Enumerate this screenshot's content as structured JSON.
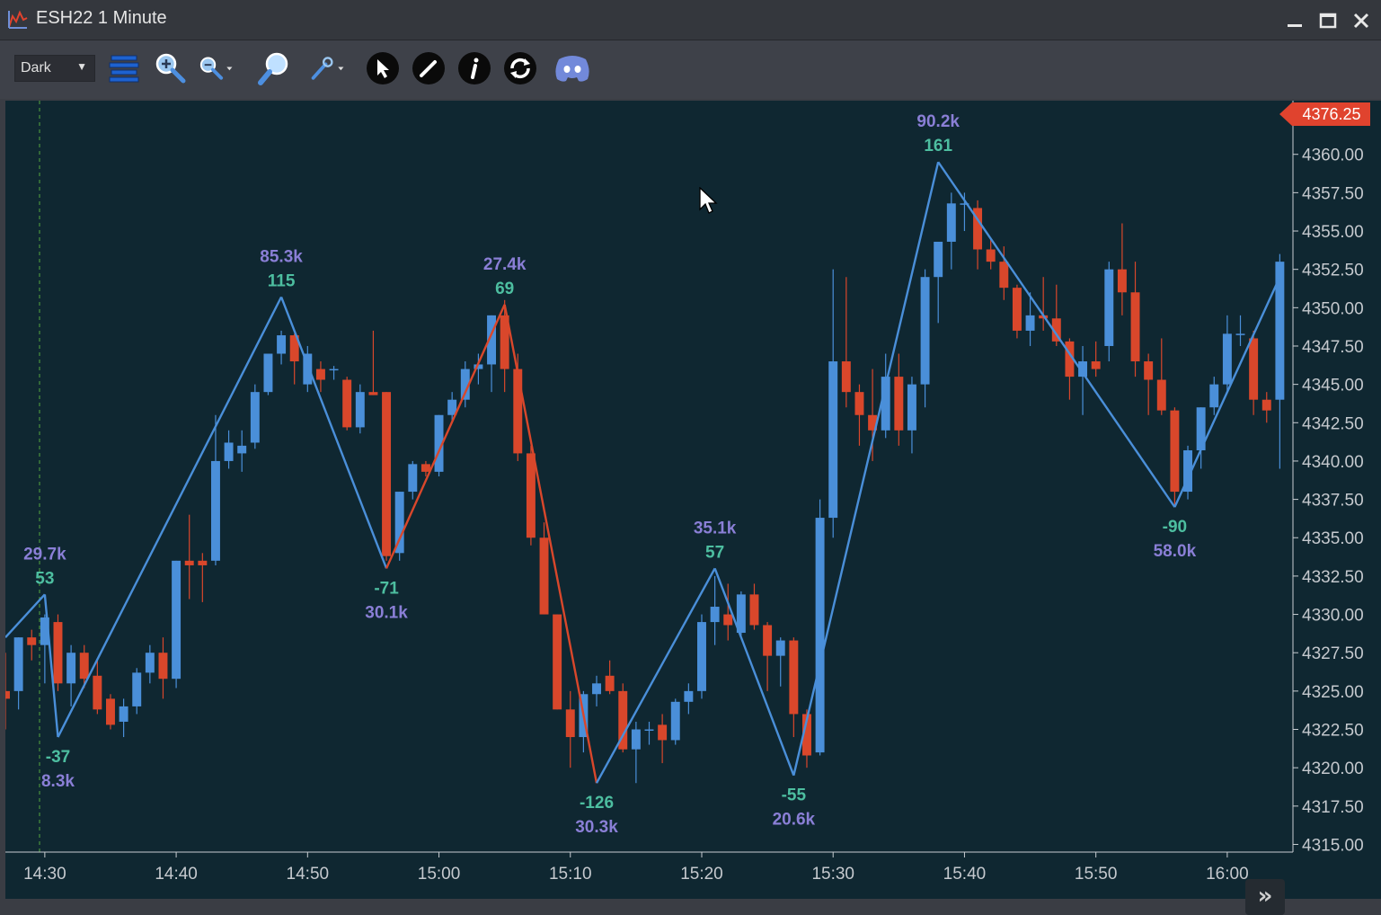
{
  "window": {
    "title": "ESH22 1 Minute"
  },
  "toolbar": {
    "theme_value": "Dark",
    "buttons": [
      {
        "icon": "strip-bars-icon"
      },
      {
        "icon": "zoom-in-icon"
      },
      {
        "icon": "zoom-out-icon"
      },
      {
        "icon": "magnifier-icon"
      },
      {
        "icon": "tools-icon"
      },
      {
        "icon": "pointer-icon"
      },
      {
        "icon": "pencil-icon"
      },
      {
        "icon": "info-icon"
      },
      {
        "icon": "refresh-icon"
      },
      {
        "icon": "discord-icon"
      }
    ]
  },
  "colors": {
    "up": "#4a8fd9",
    "down": "#d9472b",
    "zigzag": "#4a8fd9",
    "label_price": "#4dbea0",
    "label_vol": "#8a7fd6",
    "last_price_bg": "#e0432e"
  },
  "chart_data": {
    "type": "candlestick",
    "symbol": "ESH22",
    "interval": "1 Minute",
    "last_price": "4376.25",
    "x_ticks": [
      "14:30",
      "14:40",
      "14:50",
      "15:00",
      "15:10",
      "15:20",
      "15:30",
      "15:40",
      "15:50",
      "16:00"
    ],
    "y_ticks": [
      "4360.00",
      "4357.50",
      "4355.00",
      "4352.50",
      "4350.00",
      "4347.50",
      "4345.00",
      "4342.50",
      "4340.00",
      "4337.50",
      "4335.00",
      "4332.50",
      "4330.00",
      "4327.50",
      "4325.00",
      "4322.50",
      "4320.00",
      "4317.50",
      "4315.00"
    ],
    "ylim": [
      4314.5,
      4363.5
    ],
    "time_range_minutes": [
      -3,
      95
    ],
    "candles": [
      [
        -3,
        4325.0,
        4327.5,
        4322.5,
        4324.5
      ],
      [
        -2,
        4325.0,
        4328.5,
        4323.8,
        4328.5
      ],
      [
        -1,
        4328.5,
        4329.0,
        4327.0,
        4328.0
      ],
      [
        0,
        4328.0,
        4330.0,
        4325.5,
        4329.8
      ],
      [
        1,
        4329.5,
        4330.0,
        4325.0,
        4325.5
      ],
      [
        2,
        4325.5,
        4328.0,
        4324.0,
        4327.5
      ],
      [
        3,
        4327.5,
        4328.0,
        4325.2,
        4325.8
      ],
      [
        4,
        4326.0,
        4327.0,
        4323.5,
        4323.8
      ],
      [
        5,
        4324.5,
        4324.8,
        4322.5,
        4322.8
      ],
      [
        6,
        4323.0,
        4324.5,
        4322.0,
        4324.0
      ],
      [
        7,
        4324.0,
        4326.5,
        4323.5,
        4326.2
      ],
      [
        8,
        4326.2,
        4328.0,
        4325.5,
        4327.5
      ],
      [
        9,
        4327.5,
        4328.5,
        4324.5,
        4325.8
      ],
      [
        10,
        4325.8,
        4333.5,
        4325.2,
        4333.5
      ],
      [
        11,
        4333.5,
        4336.5,
        4331.0,
        4333.2
      ],
      [
        12,
        4333.5,
        4334.0,
        4330.8,
        4333.2
      ],
      [
        13,
        4333.5,
        4343.0,
        4333.2,
        4340.0
      ],
      [
        14,
        4340.0,
        4342.0,
        4339.5,
        4341.2
      ],
      [
        15,
        4340.5,
        4342.0,
        4339.3,
        4341.0
      ],
      [
        16,
        4341.2,
        4345.0,
        4340.8,
        4344.5
      ],
      [
        17,
        4344.5,
        4347.0,
        4344.3,
        4347.0
      ],
      [
        18,
        4347.0,
        4348.5,
        4346.3,
        4348.2
      ],
      [
        19,
        4348.2,
        4348.3,
        4345.0,
        4346.5
      ],
      [
        20,
        4345.0,
        4347.5,
        4344.5,
        4347.0
      ],
      [
        21,
        4346.0,
        4346.5,
        4344.5,
        4345.3
      ],
      [
        22,
        4346.0,
        4346.2,
        4345.3,
        4346.0
      ],
      [
        23,
        4345.3,
        4345.5,
        4342.0,
        4342.2
      ],
      [
        24,
        4342.2,
        4345.0,
        4341.8,
        4344.5
      ],
      [
        25,
        4344.5,
        4348.5,
        4344.3,
        4344.3
      ],
      [
        26,
        4344.5,
        4344.5,
        4333.5,
        4333.8
      ],
      [
        27,
        4334.0,
        4338.0,
        4333.5,
        4338.0
      ],
      [
        28,
        4338.0,
        4340.0,
        4337.5,
        4339.8
      ],
      [
        29,
        4339.8,
        4340.0,
        4339.0,
        4339.3
      ],
      [
        30,
        4339.3,
        4343.0,
        4339.0,
        4343.0
      ],
      [
        31,
        4343.0,
        4344.5,
        4342.5,
        4344.0
      ],
      [
        32,
        4344.0,
        4346.5,
        4343.5,
        4346.0
      ],
      [
        33,
        4346.0,
        4347.0,
        4345.0,
        4346.3
      ],
      [
        34,
        4346.3,
        4349.5,
        4344.5,
        4349.5
      ],
      [
        35,
        4349.5,
        4350.5,
        4344.5,
        4346.0
      ],
      [
        36,
        4346.0,
        4347.0,
        4340.0,
        4340.5
      ],
      [
        37,
        4340.5,
        4341.0,
        4334.5,
        4335.0
      ],
      [
        38,
        4335.0,
        4336.0,
        4330.0,
        4330.0
      ],
      [
        39,
        4330.0,
        4330.0,
        4323.8,
        4323.8
      ],
      [
        40,
        4323.8,
        4325.0,
        4320.0,
        4322.0
      ],
      [
        41,
        4322.0,
        4325.0,
        4321.0,
        4324.8
      ],
      [
        42,
        4324.8,
        4326.0,
        4324.0,
        4325.5
      ],
      [
        43,
        4326.0,
        4327.0,
        4324.8,
        4325.0
      ],
      [
        44,
        4325.0,
        4325.5,
        4321.0,
        4321.2
      ],
      [
        45,
        4321.2,
        4323.0,
        4319.0,
        4322.5
      ],
      [
        46,
        4322.5,
        4323.0,
        4321.5,
        4322.5
      ],
      [
        47,
        4322.8,
        4323.5,
        4320.3,
        4321.8
      ],
      [
        48,
        4321.8,
        4324.5,
        4321.5,
        4324.3
      ],
      [
        49,
        4324.3,
        4325.5,
        4323.5,
        4325.0
      ],
      [
        50,
        4325.0,
        4330.0,
        4324.5,
        4329.5
      ],
      [
        51,
        4329.5,
        4332.5,
        4328.0,
        4330.5
      ],
      [
        52,
        4330.0,
        4332.0,
        4328.3,
        4329.3
      ],
      [
        53,
        4328.8,
        4331.5,
        4328.5,
        4331.3
      ],
      [
        54,
        4331.3,
        4332.0,
        4329.0,
        4329.3
      ],
      [
        55,
        4329.3,
        4329.5,
        4325.0,
        4327.3
      ],
      [
        56,
        4327.3,
        4328.5,
        4325.3,
        4328.3
      ],
      [
        57,
        4328.3,
        4328.5,
        4322.0,
        4323.5
      ],
      [
        58,
        4323.5,
        4323.8,
        4320.0,
        4320.8
      ],
      [
        59,
        4321.0,
        4337.5,
        4320.8,
        4336.3
      ],
      [
        60,
        4336.3,
        4352.5,
        4335.0,
        4346.5
      ],
      [
        61,
        4346.5,
        4352.0,
        4343.5,
        4344.5
      ],
      [
        62,
        4344.5,
        4345.0,
        4341.0,
        4343.0
      ],
      [
        63,
        4343.0,
        4346.0,
        4340.0,
        4342.0
      ],
      [
        64,
        4342.0,
        4347.0,
        4341.5,
        4345.5
      ],
      [
        65,
        4345.5,
        4347.0,
        4341.0,
        4342.0
      ],
      [
        66,
        4342.0,
        4345.5,
        4340.5,
        4345.0
      ],
      [
        67,
        4345.0,
        4352.5,
        4343.5,
        4352.0
      ],
      [
        68,
        4352.0,
        4354.0,
        4349.0,
        4354.3
      ],
      [
        69,
        4354.3,
        4357.5,
        4352.5,
        4356.8
      ],
      [
        70,
        4356.8,
        4357.5,
        4355.0,
        4356.8
      ],
      [
        71,
        4356.5,
        4357.0,
        4352.5,
        4353.8
      ],
      [
        72,
        4353.8,
        4354.5,
        4352.5,
        4353.0
      ],
      [
        73,
        4353.0,
        4354.0,
        4350.5,
        4351.3
      ],
      [
        74,
        4351.3,
        4351.5,
        4348.0,
        4348.5
      ],
      [
        75,
        4348.5,
        4351.0,
        4347.5,
        4349.5
      ],
      [
        76,
        4349.5,
        4352.0,
        4348.5,
        4349.3
      ],
      [
        77,
        4349.3,
        4351.5,
        4347.5,
        4347.8
      ],
      [
        78,
        4347.8,
        4348.0,
        4344.0,
        4345.5
      ],
      [
        79,
        4345.5,
        4347.5,
        4343.0,
        4346.5
      ],
      [
        80,
        4346.5,
        4347.8,
        4345.5,
        4346.0
      ],
      [
        81,
        4347.5,
        4353.0,
        4346.5,
        4352.5
      ],
      [
        82,
        4352.5,
        4355.5,
        4349.5,
        4351.0
      ],
      [
        83,
        4351.0,
        4353.0,
        4345.5,
        4346.5
      ],
      [
        84,
        4346.5,
        4347.0,
        4343.0,
        4345.3
      ],
      [
        85,
        4345.3,
        4348.0,
        4343.0,
        4343.3
      ],
      [
        86,
        4343.3,
        4343.5,
        4337.0,
        4338.0
      ],
      [
        87,
        4338.0,
        4341.0,
        4337.5,
        4340.7
      ],
      [
        88,
        4340.7,
        4343.5,
        4339.5,
        4343.5
      ],
      [
        89,
        4343.5,
        4345.5,
        4343.0,
        4345.0
      ],
      [
        90,
        4345.0,
        4349.5,
        4344.5,
        4348.3
      ],
      [
        91,
        4348.3,
        4349.5,
        4347.5,
        4348.3
      ],
      [
        92,
        4348.0,
        4348.5,
        4343.0,
        4344.0
      ],
      [
        93,
        4344.0,
        4344.5,
        4342.5,
        4343.3
      ],
      [
        94,
        4344.0,
        4353.5,
        4339.5,
        4353.0
      ]
    ],
    "zigzag": [
      {
        "t": -3,
        "p": 4328.5
      },
      {
        "t": 0,
        "p": 4331.3
      },
      {
        "t": 1,
        "p": 4322.0
      },
      {
        "t": 18,
        "p": 4350.7
      },
      {
        "t": 26,
        "p": 4333.0
      },
      {
        "t": 35,
        "p": 4350.2
      },
      {
        "t": 42,
        "p": 4319.0
      },
      {
        "t": 51,
        "p": 4333.0
      },
      {
        "t": 57,
        "p": 4319.5
      },
      {
        "t": 68,
        "p": 4359.5
      },
      {
        "t": 86,
        "p": 4337.0
      },
      {
        "t": 94,
        "p": 4352.0
      }
    ],
    "red_zigzag_segments": [
      [
        26,
        35
      ],
      [
        35,
        42
      ]
    ],
    "pivot_labels": [
      {
        "t": 0,
        "p": 4331.3,
        "pos": "above",
        "vol": "29.7k",
        "delta": "53"
      },
      {
        "t": 1,
        "p": 4322.0,
        "pos": "below",
        "delta": "-37",
        "vol": "8.3k"
      },
      {
        "t": 18,
        "p": 4350.7,
        "pos": "above",
        "vol": "85.3k",
        "delta": "115"
      },
      {
        "t": 26,
        "p": 4333.0,
        "pos": "below",
        "delta": "-71",
        "vol": "30.1k"
      },
      {
        "t": 35,
        "p": 4350.2,
        "pos": "above",
        "vol": "27.4k",
        "delta": "69"
      },
      {
        "t": 42,
        "p": 4319.0,
        "pos": "below",
        "delta": "-126",
        "vol": "30.3k"
      },
      {
        "t": 51,
        "p": 4333.0,
        "pos": "above",
        "vol": "35.1k",
        "delta": "57"
      },
      {
        "t": 57,
        "p": 4319.5,
        "pos": "below",
        "delta": "-55",
        "vol": "20.6k"
      },
      {
        "t": 68,
        "p": 4359.5,
        "pos": "above",
        "vol": "90.2k",
        "delta": "161"
      },
      {
        "t": 86,
        "p": 4337.0,
        "pos": "below",
        "delta": "-90",
        "vol": "58.0k"
      }
    ]
  }
}
